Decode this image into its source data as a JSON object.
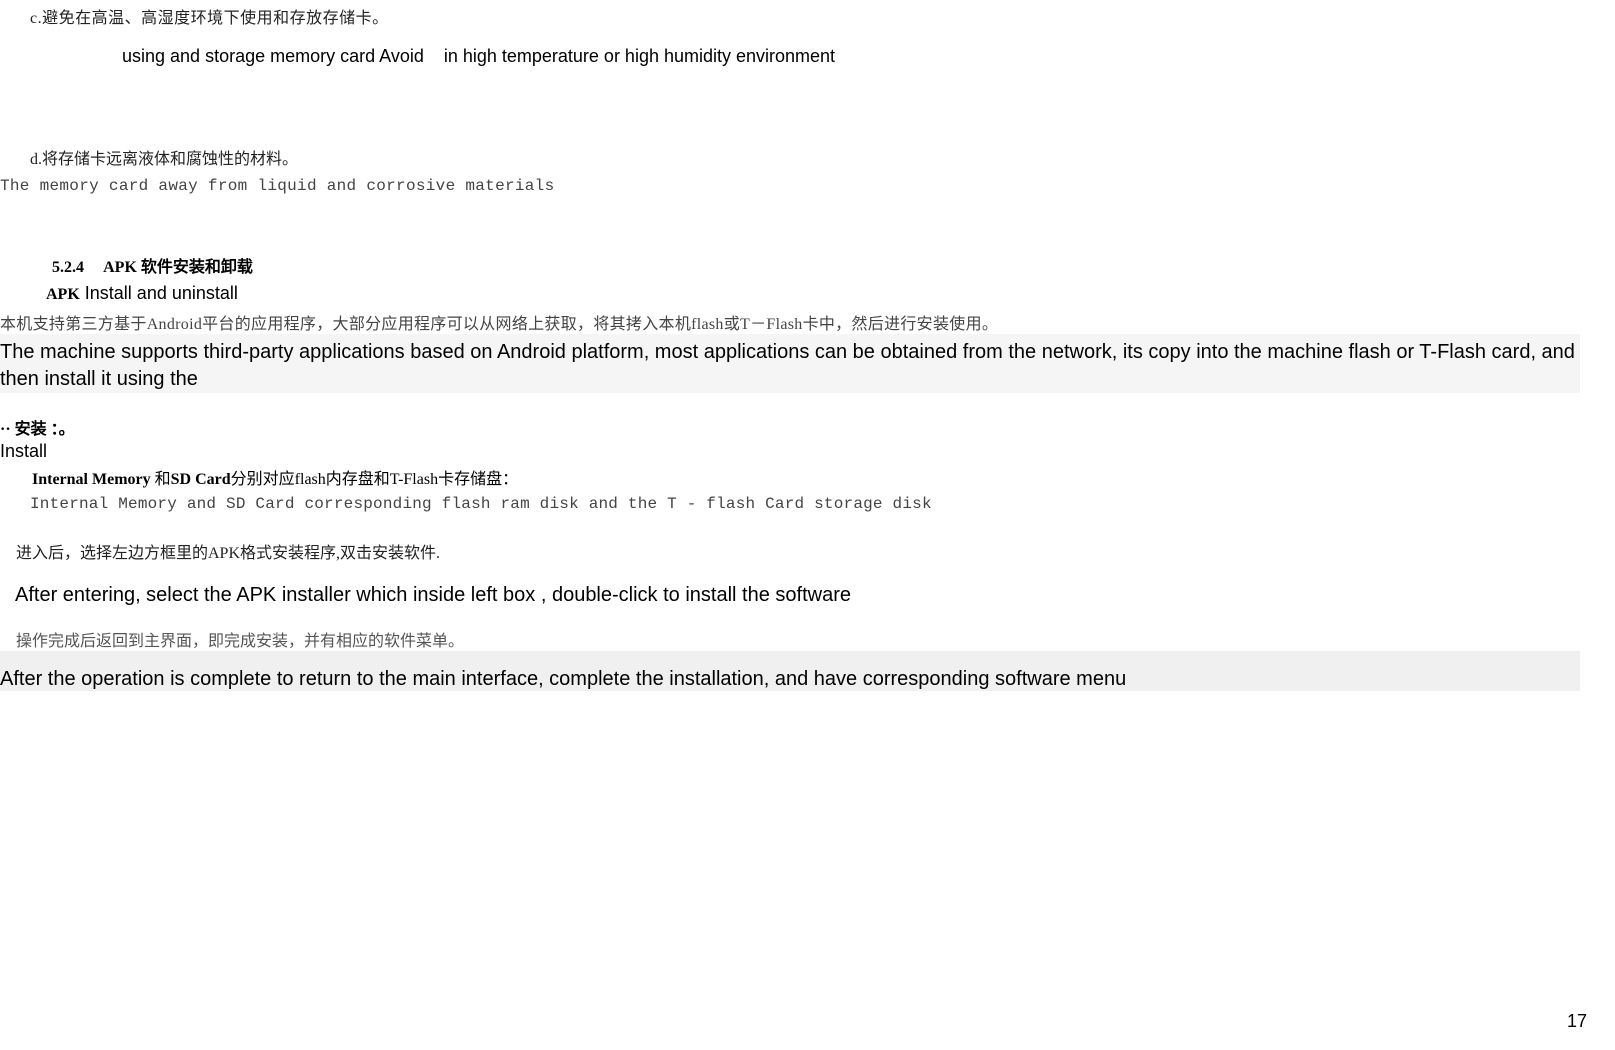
{
  "point_c": {
    "cn": "c.避免在高温、高湿度环境下使用和存放存储卡。",
    "en": "using and storage memory card Avoid    in high temperature or high humidity environment"
  },
  "point_d": {
    "cn": "d.将存储卡远离液体和腐蚀性的材料。",
    "en": "The memory card away from liquid and corrosive materials"
  },
  "section_524": {
    "num": "5.2.4",
    "title_cn": "APK 软件安装和卸载",
    "title_en_apk": "APK",
    "title_en": " Install and uninstall"
  },
  "para1": {
    "cn": "本机支持第三方基于Android平台的应用程序，大部分应用程序可以从网络上获取，将其拷入本机flash或T－Flash卡中，然后进行安装使用。",
    "en": "The machine supports third-party applications based on Android platform, most applications can be obtained from the network, its copy into the machine flash or T-Flash card, and then install it using the"
  },
  "install": {
    "heading_cn": "·· 安装 ：。",
    "heading_en": "Install",
    "internal_cn_bold1": "Internal Memory",
    "internal_cn_mid": " 和",
    "internal_cn_bold2": "SD Card",
    "internal_cn_tail": "分别对应flash内存盘和T-Flash卡存储盘：",
    "internal_en": "Internal Memory and SD Card corresponding flash ram disk and the T - flash Card storage disk"
  },
  "enter": {
    "cn": "进入后，选择左边方框里的APK格式安装程序,双击安装软件.",
    "en": "After entering, select the APK installer which inside left box , double-click to install the software"
  },
  "complete": {
    "cn": "操作完成后返回到主界面，即完成安装，并有相应的软件菜单。",
    "en": "After the operation is complete to return to the main interface, complete the installation, and have corresponding software menu"
  },
  "page_number": "17"
}
